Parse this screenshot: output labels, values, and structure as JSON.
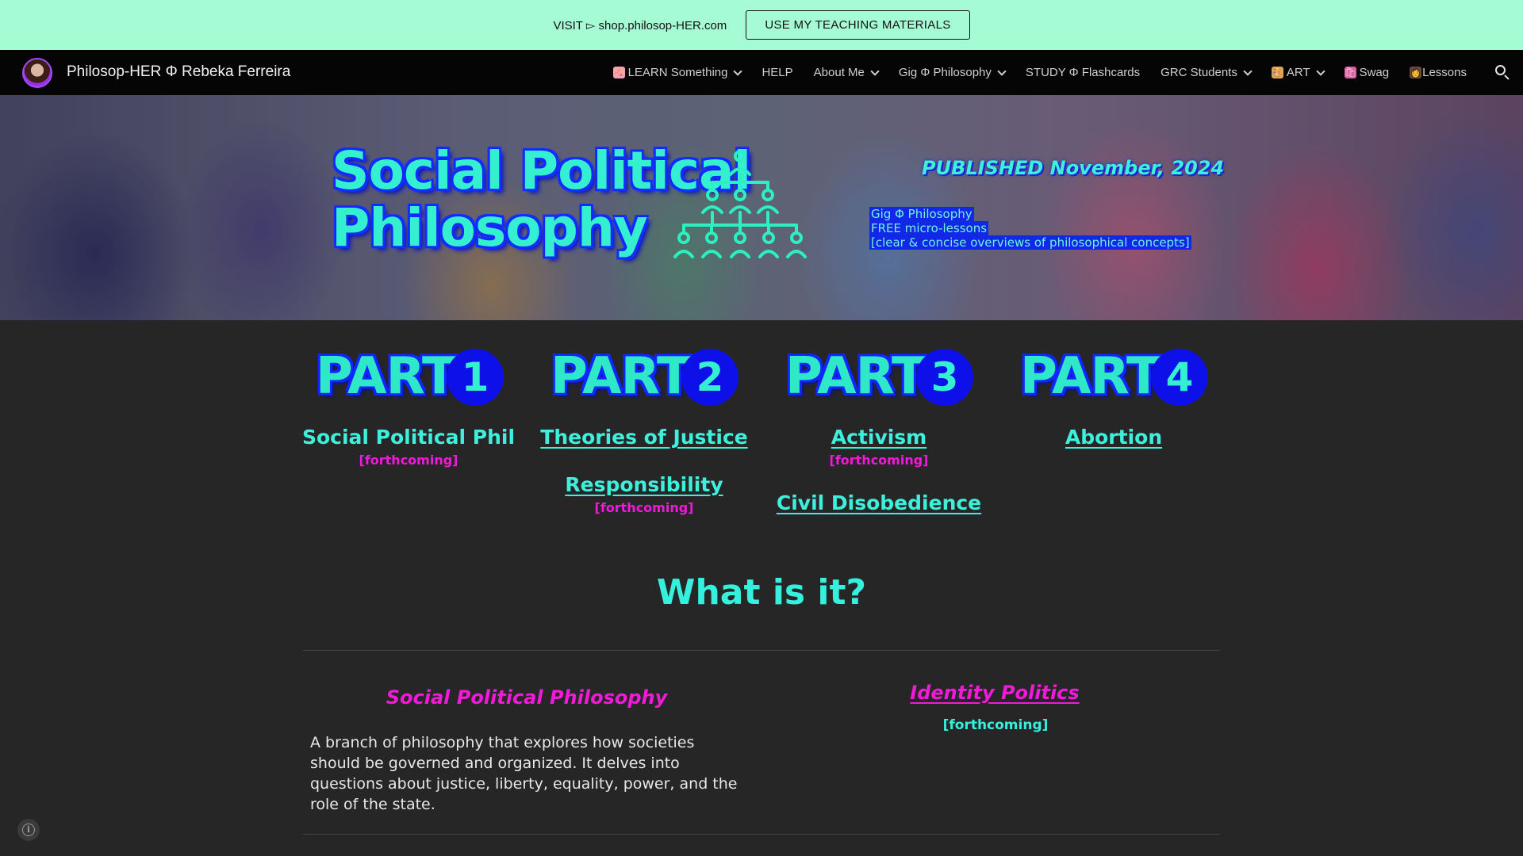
{
  "announcement": {
    "text": "VISIT ▻ shop.philosop-HER.com",
    "button_label": "USE MY TEACHING MATERIALS"
  },
  "nav": {
    "site_title": "Philosop-HER Φ Rebeka Ferreira",
    "items": [
      {
        "label": "LEARN Something",
        "icon": "brain-emoji",
        "dropdown": true
      },
      {
        "label": "HELP",
        "icon": "",
        "dropdown": false
      },
      {
        "label": "About Me",
        "icon": "",
        "dropdown": true
      },
      {
        "label": "Gig Φ Philosophy",
        "icon": "",
        "dropdown": true
      },
      {
        "label": "STUDY Φ Flashcards",
        "icon": "",
        "dropdown": false
      },
      {
        "label": "GRC Students",
        "icon": "",
        "dropdown": true
      },
      {
        "label": "ART",
        "icon": "palette-emoji",
        "dropdown": true
      },
      {
        "label": "Swag",
        "icon": "shopping-bags-emoji",
        "dropdown": false
      },
      {
        "label": "Lessons",
        "icon": "teacher-emoji",
        "dropdown": false
      }
    ]
  },
  "hero": {
    "title_line1": "Social Political",
    "title_line2": "Philosophy",
    "published": "PUBLISHED November, 2024",
    "sub_line1": "Gig Φ Philosophy",
    "sub_line2": "FREE micro-lessons",
    "sub_line3": "[clear & concise overviews of philosophical concepts]"
  },
  "parts": [
    {
      "word": "PART",
      "number": "1"
    },
    {
      "word": "PART",
      "number": "2"
    },
    {
      "word": "PART",
      "number": "3"
    },
    {
      "word": "PART",
      "number": "4"
    }
  ],
  "columns": {
    "c1_link": "Social Political Phil",
    "c1_status": "[forthcoming]",
    "c2_link1": "Theories of Justice",
    "c2_link2": "Responsibility",
    "c2_status": "[forthcoming]",
    "c3_link1": "Activism",
    "c3_status": "[forthcoming]",
    "c3_link2": "Civil Disobedience",
    "c4_link": "Abortion"
  },
  "what_heading": "What is it?",
  "definition": {
    "title": "Social Political Philosophy",
    "body": "A branch of philosophy that explores how societies should be governed and organized. It delves into questions about justice, liberty, equality, power, and the role of the state."
  },
  "identity": {
    "title": "Identity Politics",
    "status": "[forthcoming]"
  },
  "colors": {
    "accent_teal": "#35f0dc",
    "accent_magenta": "#f01ad8",
    "accent_blue": "#0d10e8",
    "announce_bg": "#a5fbd3"
  }
}
